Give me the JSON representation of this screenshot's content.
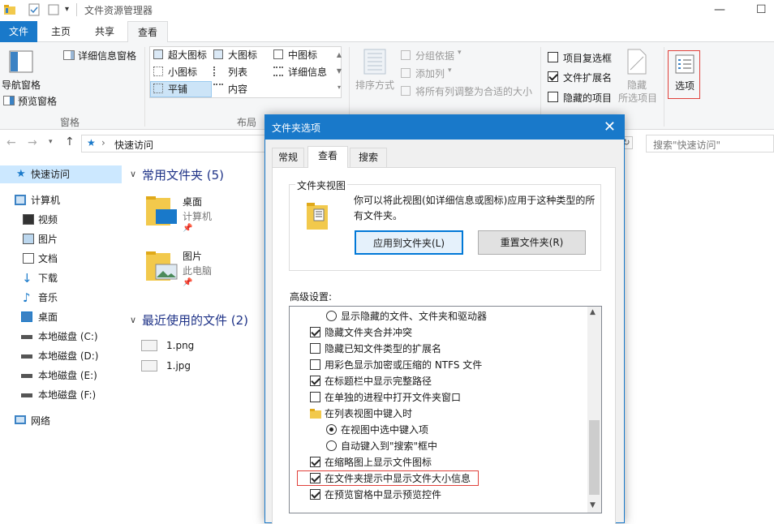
{
  "window": {
    "title": "文件资源管理器"
  },
  "ribbon_tabs": [
    "文件",
    "主页",
    "共享",
    "查看"
  ],
  "ribbon": {
    "panes": {
      "nav_pane": "导航窗格",
      "preview_pane": "预览窗格",
      "details_pane": "详细信息窗格",
      "group": "窗格"
    },
    "layout": {
      "items": [
        "超大图标",
        "大图标",
        "中图标",
        "小图标",
        "列表",
        "详细信息",
        "平铺",
        "内容"
      ],
      "selected": "平铺",
      "group": "布局"
    },
    "current_view": {
      "sort_by": "排序方式",
      "group_by": "分组依据",
      "add_columns": "添加列",
      "fit_columns": "将所有列调整为合适的大小"
    },
    "show_hide": {
      "item_checkboxes": "项目复选框",
      "item_checkboxes_checked": false,
      "file_extensions": "文件扩展名",
      "file_extensions_checked": true,
      "hidden_items": "隐藏的项目",
      "hidden_items_checked": false,
      "hide_selected": "隐藏",
      "hide_selected_sub": "所选项目"
    },
    "options": "选项"
  },
  "navbar": {
    "breadcrumb": "快速访问",
    "search_placeholder": "搜索\"快速访问\""
  },
  "nav_pane": [
    {
      "label": "快速访问",
      "icon": "star-icon",
      "selected": true
    },
    {
      "label": "计算机",
      "icon": "computer-icon"
    },
    {
      "label": "视频",
      "icon": "video-icon"
    },
    {
      "label": "图片",
      "icon": "pictures-icon"
    },
    {
      "label": "文档",
      "icon": "document-icon"
    },
    {
      "label": "下载",
      "icon": "download-icon"
    },
    {
      "label": "音乐",
      "icon": "music-icon"
    },
    {
      "label": "桌面",
      "icon": "desktop-icon"
    },
    {
      "label": "本地磁盘 (C:)",
      "icon": "drive-icon"
    },
    {
      "label": "本地磁盘 (D:)",
      "icon": "drive-icon"
    },
    {
      "label": "本地磁盘 (E:)",
      "icon": "drive-icon"
    },
    {
      "label": "本地磁盘 (F:)",
      "icon": "drive-icon"
    },
    {
      "label": "网络",
      "icon": "network-icon"
    }
  ],
  "content": {
    "frequent_header": "常用文件夹 (5)",
    "frequent": [
      {
        "name": "桌面",
        "location": "计算机"
      },
      {
        "name": "图片",
        "location": "此电脑"
      }
    ],
    "recent_header": "最近使用的文件 (2)",
    "recent": [
      {
        "name": "1.png"
      },
      {
        "name": "1.jpg"
      }
    ]
  },
  "dialog": {
    "title": "文件夹选项",
    "tabs": [
      "常规",
      "查看",
      "搜索"
    ],
    "active_tab": "查看",
    "folder_view": {
      "title": "文件夹视图",
      "description": "你可以将此视图(如详细信息或图标)应用于这种类型的所有文件夹。",
      "apply_button": "应用到文件夹(L)",
      "reset_button": "重置文件夹(R)"
    },
    "advanced_label": "高级设置:",
    "settings": [
      {
        "type": "radio",
        "label": "显示隐藏的文件、文件夹和驱动器",
        "checked": false,
        "indent": 1
      },
      {
        "type": "check",
        "label": "隐藏文件夹合并冲突",
        "checked": true,
        "indent": 0
      },
      {
        "type": "check",
        "label": "隐藏已知文件类型的扩展名",
        "checked": false,
        "indent": 0
      },
      {
        "type": "check",
        "label": "用彩色显示加密或压缩的 NTFS 文件",
        "checked": false,
        "indent": 0
      },
      {
        "type": "check",
        "label": "在标题栏中显示完整路径",
        "checked": true,
        "indent": 0
      },
      {
        "type": "check",
        "label": "在单独的进程中打开文件夹窗口",
        "checked": false,
        "indent": 0
      },
      {
        "type": "folder",
        "label": "在列表视图中键入时",
        "indent": 0
      },
      {
        "type": "radio",
        "label": "在视图中选中键入项",
        "checked": true,
        "indent": 1
      },
      {
        "type": "radio",
        "label": "自动键入到\"搜索\"框中",
        "checked": false,
        "indent": 1
      },
      {
        "type": "check",
        "label": "在缩略图上显示文件图标",
        "checked": true,
        "indent": 0
      },
      {
        "type": "check",
        "label": "在文件夹提示中显示文件大小信息",
        "checked": true,
        "indent": 0,
        "highlighted": true
      },
      {
        "type": "check",
        "label": "在预览窗格中显示预览控件",
        "checked": true,
        "indent": 0
      }
    ]
  },
  "colors": {
    "accent": "#1979ca",
    "highlight": "#e0413b",
    "section": "#1e3287"
  }
}
